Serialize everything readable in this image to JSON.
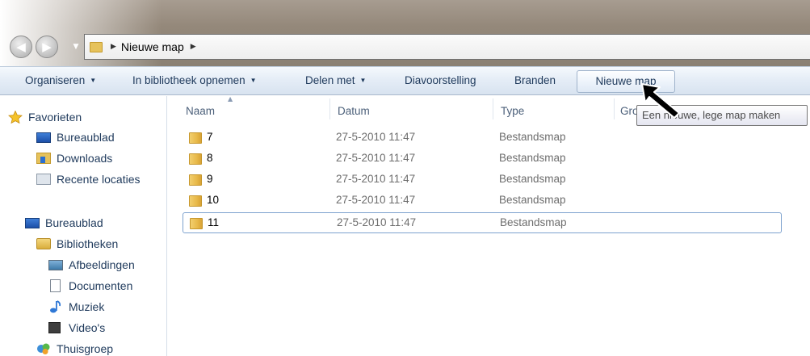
{
  "address": {
    "path_item": "Nieuwe map"
  },
  "toolbar": {
    "organize": "Organiseren",
    "include_library": "In bibliotheek opnemen",
    "share": "Delen met",
    "slideshow": "Diavoorstelling",
    "burn": "Branden",
    "new_folder": "Nieuwe map"
  },
  "tooltip": "Een nieuwe, lege map maken",
  "columns": {
    "name": "Naam",
    "date": "Datum",
    "type": "Type",
    "size_partial": "Gro"
  },
  "sidebar": {
    "favorites": "Favorieten",
    "desktop_fav": "Bureaublad",
    "downloads": "Downloads",
    "recent": "Recente locaties",
    "desktop": "Bureaublad",
    "libraries": "Bibliotheken",
    "pictures": "Afbeeldingen",
    "documents": "Documenten",
    "music": "Muziek",
    "videos": "Video's",
    "homegroup": "Thuisgroep"
  },
  "files": [
    {
      "name": "7",
      "date": "27-5-2010 11:47",
      "type": "Bestandsmap"
    },
    {
      "name": "8",
      "date": "27-5-2010 11:47",
      "type": "Bestandsmap"
    },
    {
      "name": "9",
      "date": "27-5-2010 11:47",
      "type": "Bestandsmap"
    },
    {
      "name": "10",
      "date": "27-5-2010 11:47",
      "type": "Bestandsmap"
    },
    {
      "name": "11",
      "date": "27-5-2010 11:47",
      "type": "Bestandsmap"
    }
  ],
  "colors": {
    "accent": "#1e395b",
    "selection_border": "#7da2ce",
    "folder": "#e8b94a"
  }
}
